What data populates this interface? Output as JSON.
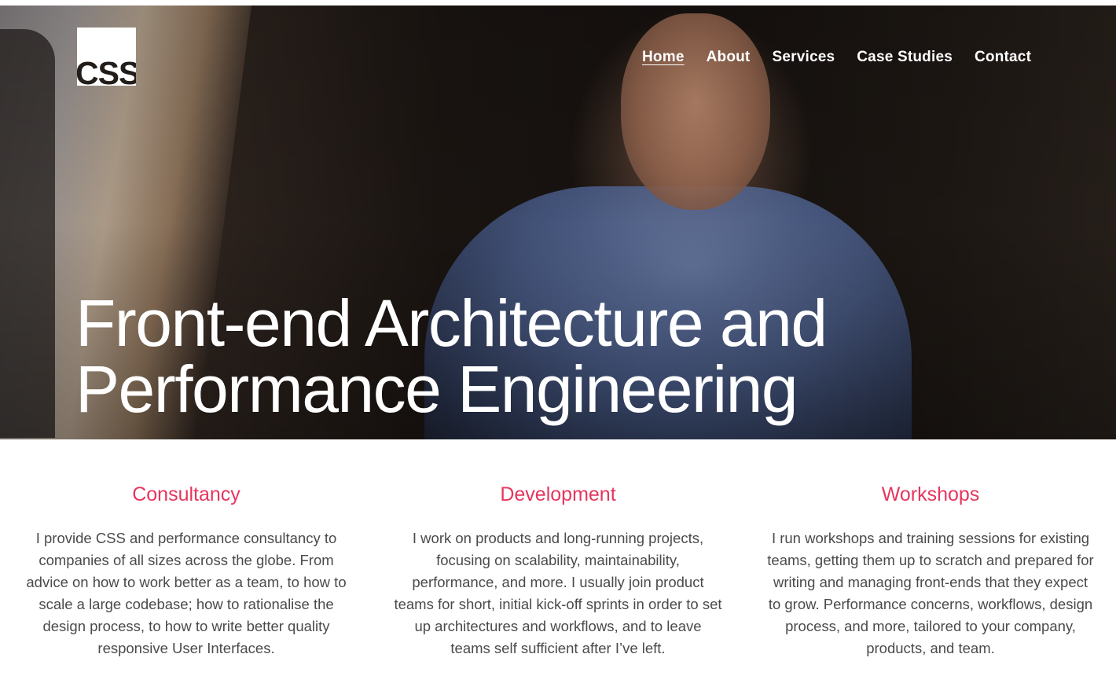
{
  "brand": {
    "logo_text": "CSS"
  },
  "nav": {
    "items": [
      {
        "label": "Home",
        "active": true
      },
      {
        "label": "About",
        "active": false
      },
      {
        "label": "Services",
        "active": false
      },
      {
        "label": "Case Studies",
        "active": false
      },
      {
        "label": "Contact",
        "active": false
      }
    ]
  },
  "hero": {
    "title_line1": "Front-end Architecture and",
    "title_line2": "Performance Engineering"
  },
  "services": [
    {
      "title": "Consultancy",
      "body": "I provide CSS and performance consultancy to companies of all sizes across the globe. From advice on how to work better as a team, to how to scale a large codebase; how to rationalise the design process, to how to write better quality responsive User Interfaces."
    },
    {
      "title": "Development",
      "body": "I work on products and long-running projects, focusing on scalability, maintainability, performance, and more. I usually join product teams for short, initial kick-off sprints in order to set up architectures and workflows, and to leave teams self sufficient after I’ve left."
    },
    {
      "title": "Workshops",
      "body": "I run workshops and training sessions for existing teams, getting them up to scratch and prepared for writing and managing front-ends that they expect to grow. Performance concerns, workflows, design process, and more, tailored to your company, products, and team."
    }
  ],
  "colors": {
    "accent": "#e5365f",
    "text": "#4a4a4a",
    "hero_text": "#ffffff"
  }
}
